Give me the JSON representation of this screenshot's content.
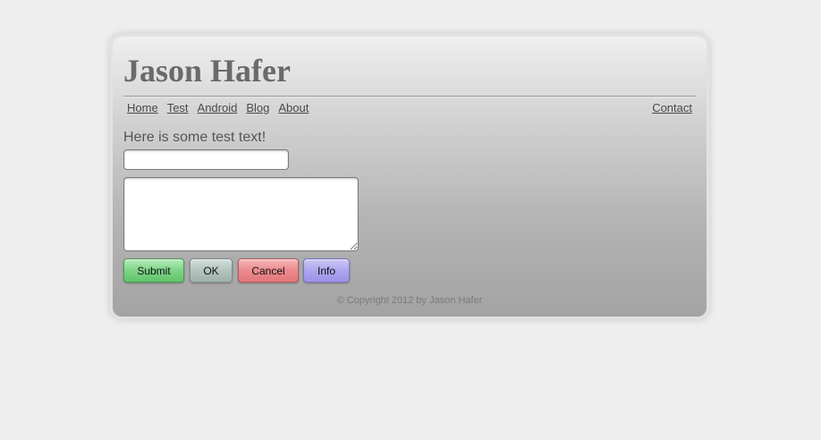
{
  "header": {
    "title": "Jason Hafer"
  },
  "nav": {
    "items": [
      "Home",
      "Test",
      "Android",
      "Blog",
      "About"
    ],
    "contact": "Contact"
  },
  "content": {
    "intro": "Here is some test text!",
    "text_input_value": "",
    "textarea_value": ""
  },
  "buttons": {
    "submit": "Submit",
    "ok": "OK",
    "cancel": "Cancel",
    "info": "Info"
  },
  "footer": {
    "copyright": "© Copyright 2012 by Jason Hafer"
  },
  "colors": {
    "page_background": "#eeeeee",
    "submit": "#7fd487",
    "ok": "#b3c3be",
    "cancel": "#eb8a8d",
    "info": "#ada5ee"
  }
}
